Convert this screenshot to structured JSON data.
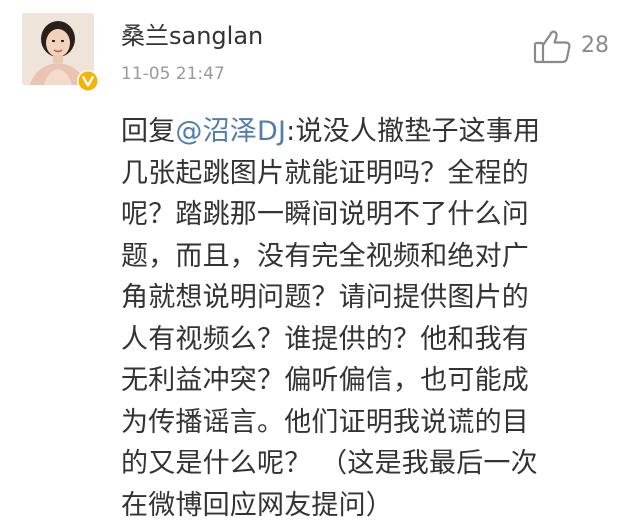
{
  "comment": {
    "username": "桑兰sanglan",
    "timestamp": "11-05 21:47",
    "likes": "28",
    "reply_prefix": "回复",
    "mention": "@沼泽DJ",
    "lines": [
      ":说没人撤垫子这事用",
      "几张起跳图片就能证明吗？全程的",
      "呢？踏跳那一瞬间说明不了什么问",
      "题，而且，没有完全视频和绝对广",
      "角就想说明问题？请问提供图片的",
      "人有视频么？谁提供的？他和我有",
      "无利益冲突？偏听偏信，也可能成",
      "为传播谣言。他们证明我说谎的目",
      "的又是什么呢？ （这是我最后一次",
      "在微博回应网友提问）"
    ]
  },
  "colors": {
    "mention": "#507daf",
    "verified_badge": "#f5b400",
    "timestamp": "#9a9a9a",
    "text": "#333333"
  },
  "icons": {
    "like": "thumbs-up-icon",
    "verified": "verified-badge-icon"
  }
}
